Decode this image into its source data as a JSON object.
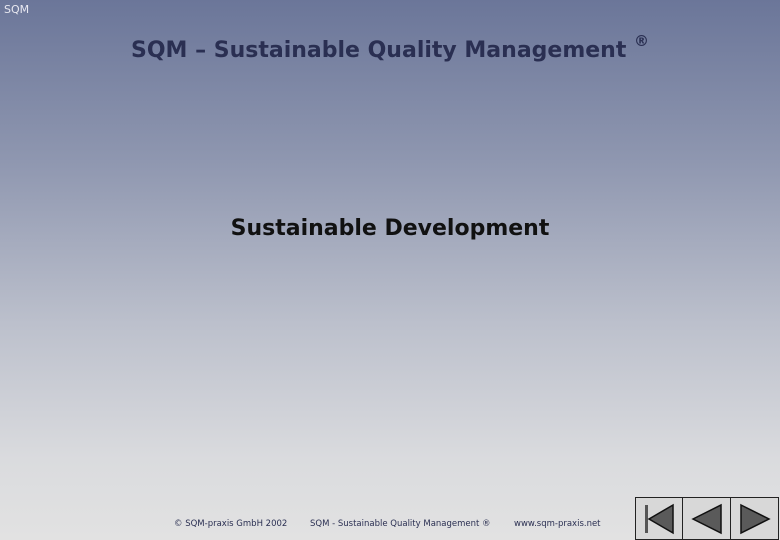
{
  "header": {
    "logo_text": "SQM",
    "title": "SQM – Sustainable Quality Management",
    "title_mark": "®"
  },
  "main": {
    "subtitle": "Sustainable Development"
  },
  "footer": {
    "copyright": "© SQM-praxis GmbH 2002",
    "product": "SQM - Sustainable Quality Management ®",
    "url": "www.sqm-praxis.net"
  },
  "nav": {
    "buttons": [
      {
        "icon": "first-slide-icon"
      },
      {
        "icon": "previous-slide-icon"
      },
      {
        "icon": "next-slide-icon"
      }
    ]
  },
  "colors": {
    "title": "#2a2f52",
    "subtitle": "#111111",
    "bg_top": "#6b7699",
    "bg_bottom": "#e2e2e2"
  }
}
